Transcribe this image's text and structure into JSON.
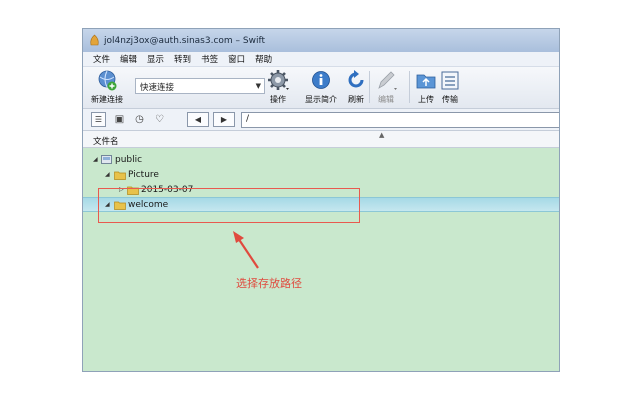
{
  "window": {
    "title": "jol4nzj3ox@auth.sinas3.com – Swift"
  },
  "menu": [
    "文件",
    "编辑",
    "显示",
    "转到",
    "书签",
    "窗口",
    "帮助"
  ],
  "toolbar": {
    "new_connection": "新建连接",
    "quick_connect": "快速连接",
    "action": "操作",
    "info": "显示简介",
    "refresh": "刷新",
    "edit": "编辑",
    "upload": "上传",
    "transfer": "传输"
  },
  "navbar": {
    "back": "◀",
    "forward": "▶",
    "path": "/"
  },
  "columns": {
    "name": "文件名"
  },
  "tree": [
    {
      "label": "public",
      "level": 0,
      "expanded": true,
      "type": "bucket"
    },
    {
      "label": "Picture",
      "level": 1,
      "expanded": true,
      "type": "folder"
    },
    {
      "label": "2015-03-07",
      "level": 2,
      "expanded": false,
      "type": "folder"
    },
    {
      "label": "welcome",
      "level": 1,
      "expanded": true,
      "type": "folder",
      "selected": true
    }
  ],
  "annotation": {
    "text": "选择存放路径",
    "color": "#e04a3e"
  },
  "colors": {
    "list_background": "#c9e8cd",
    "selection": "#a6d9e6",
    "annotation": "#e85a4f"
  }
}
